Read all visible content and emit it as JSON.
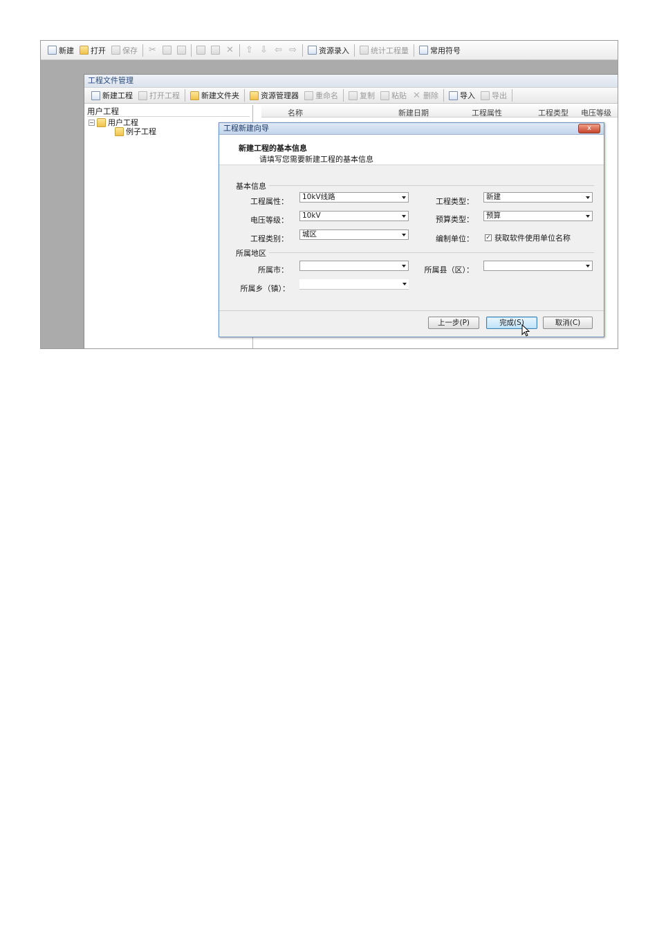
{
  "main_toolbar": {
    "new": "新建",
    "open": "打开",
    "save": "保存",
    "resource_entry": "资源录入",
    "stat_quantity": "统计工程量",
    "common_symbols": "常用符号"
  },
  "project_window": {
    "title": "工程文件管理",
    "toolbar": {
      "new_project": "新建工程",
      "open_project": "打开工程",
      "new_folder": "新建文件夹",
      "resource_manager": "资源管理器",
      "rename": "重命名",
      "copy": "复制",
      "paste": "粘贴",
      "delete": "删除",
      "import": "导入",
      "export": "导出"
    },
    "tree": {
      "header": "用户工程",
      "root": "用户工程",
      "child": "例子工程"
    },
    "columns": [
      "名称",
      "新建日期",
      "工程属性",
      "工程类型",
      "电压等级"
    ]
  },
  "dialog": {
    "title": "工程新建向导",
    "close_label": "x",
    "heading": "新建工程的基本信息",
    "subheading": "请填写您需要新建工程的基本信息",
    "basic_group": "基本信息",
    "fields": {
      "attr_label": "工程属性：",
      "attr_value": "10kV线路",
      "type_label": "工程类型：",
      "type_value": "新建",
      "voltage_label": "电压等级：",
      "voltage_value": "10kV",
      "budget_label": "预算类型：",
      "budget_value": "预算",
      "category_label": "工程类别：",
      "category_value": "城区",
      "unit_label": "编制单位：",
      "unit_checkbox": "获取软件使用单位名称"
    },
    "region_group": "所属地区",
    "region": {
      "city_label": "所属市：",
      "city_value": "",
      "county_label": "所属县（区）：",
      "county_value": "",
      "town_label": "所属乡（镇）：",
      "town_value": ""
    },
    "buttons": {
      "prev": "上一步(P)",
      "finish": "完成(S)",
      "cancel": "取消(C)"
    }
  }
}
